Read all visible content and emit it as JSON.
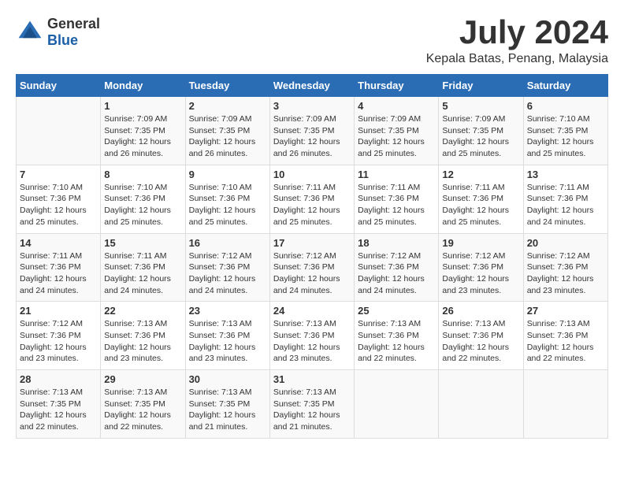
{
  "header": {
    "logo_general": "General",
    "logo_blue": "Blue",
    "month": "July 2024",
    "location": "Kepala Batas, Penang, Malaysia"
  },
  "days_of_week": [
    "Sunday",
    "Monday",
    "Tuesday",
    "Wednesday",
    "Thursday",
    "Friday",
    "Saturday"
  ],
  "weeks": [
    [
      {
        "day": "",
        "info": ""
      },
      {
        "day": "1",
        "info": "Sunrise: 7:09 AM\nSunset: 7:35 PM\nDaylight: 12 hours\nand 26 minutes."
      },
      {
        "day": "2",
        "info": "Sunrise: 7:09 AM\nSunset: 7:35 PM\nDaylight: 12 hours\nand 26 minutes."
      },
      {
        "day": "3",
        "info": "Sunrise: 7:09 AM\nSunset: 7:35 PM\nDaylight: 12 hours\nand 26 minutes."
      },
      {
        "day": "4",
        "info": "Sunrise: 7:09 AM\nSunset: 7:35 PM\nDaylight: 12 hours\nand 25 minutes."
      },
      {
        "day": "5",
        "info": "Sunrise: 7:09 AM\nSunset: 7:35 PM\nDaylight: 12 hours\nand 25 minutes."
      },
      {
        "day": "6",
        "info": "Sunrise: 7:10 AM\nSunset: 7:35 PM\nDaylight: 12 hours\nand 25 minutes."
      }
    ],
    [
      {
        "day": "7",
        "info": "Sunrise: 7:10 AM\nSunset: 7:36 PM\nDaylight: 12 hours\nand 25 minutes."
      },
      {
        "day": "8",
        "info": "Sunrise: 7:10 AM\nSunset: 7:36 PM\nDaylight: 12 hours\nand 25 minutes."
      },
      {
        "day": "9",
        "info": "Sunrise: 7:10 AM\nSunset: 7:36 PM\nDaylight: 12 hours\nand 25 minutes."
      },
      {
        "day": "10",
        "info": "Sunrise: 7:11 AM\nSunset: 7:36 PM\nDaylight: 12 hours\nand 25 minutes."
      },
      {
        "day": "11",
        "info": "Sunrise: 7:11 AM\nSunset: 7:36 PM\nDaylight: 12 hours\nand 25 minutes."
      },
      {
        "day": "12",
        "info": "Sunrise: 7:11 AM\nSunset: 7:36 PM\nDaylight: 12 hours\nand 25 minutes."
      },
      {
        "day": "13",
        "info": "Sunrise: 7:11 AM\nSunset: 7:36 PM\nDaylight: 12 hours\nand 24 minutes."
      }
    ],
    [
      {
        "day": "14",
        "info": "Sunrise: 7:11 AM\nSunset: 7:36 PM\nDaylight: 12 hours\nand 24 minutes."
      },
      {
        "day": "15",
        "info": "Sunrise: 7:11 AM\nSunset: 7:36 PM\nDaylight: 12 hours\nand 24 minutes."
      },
      {
        "day": "16",
        "info": "Sunrise: 7:12 AM\nSunset: 7:36 PM\nDaylight: 12 hours\nand 24 minutes."
      },
      {
        "day": "17",
        "info": "Sunrise: 7:12 AM\nSunset: 7:36 PM\nDaylight: 12 hours\nand 24 minutes."
      },
      {
        "day": "18",
        "info": "Sunrise: 7:12 AM\nSunset: 7:36 PM\nDaylight: 12 hours\nand 24 minutes."
      },
      {
        "day": "19",
        "info": "Sunrise: 7:12 AM\nSunset: 7:36 PM\nDaylight: 12 hours\nand 23 minutes."
      },
      {
        "day": "20",
        "info": "Sunrise: 7:12 AM\nSunset: 7:36 PM\nDaylight: 12 hours\nand 23 minutes."
      }
    ],
    [
      {
        "day": "21",
        "info": "Sunrise: 7:12 AM\nSunset: 7:36 PM\nDaylight: 12 hours\nand 23 minutes."
      },
      {
        "day": "22",
        "info": "Sunrise: 7:13 AM\nSunset: 7:36 PM\nDaylight: 12 hours\nand 23 minutes."
      },
      {
        "day": "23",
        "info": "Sunrise: 7:13 AM\nSunset: 7:36 PM\nDaylight: 12 hours\nand 23 minutes."
      },
      {
        "day": "24",
        "info": "Sunrise: 7:13 AM\nSunset: 7:36 PM\nDaylight: 12 hours\nand 23 minutes."
      },
      {
        "day": "25",
        "info": "Sunrise: 7:13 AM\nSunset: 7:36 PM\nDaylight: 12 hours\nand 22 minutes."
      },
      {
        "day": "26",
        "info": "Sunrise: 7:13 AM\nSunset: 7:36 PM\nDaylight: 12 hours\nand 22 minutes."
      },
      {
        "day": "27",
        "info": "Sunrise: 7:13 AM\nSunset: 7:36 PM\nDaylight: 12 hours\nand 22 minutes."
      }
    ],
    [
      {
        "day": "28",
        "info": "Sunrise: 7:13 AM\nSunset: 7:35 PM\nDaylight: 12 hours\nand 22 minutes."
      },
      {
        "day": "29",
        "info": "Sunrise: 7:13 AM\nSunset: 7:35 PM\nDaylight: 12 hours\nand 22 minutes."
      },
      {
        "day": "30",
        "info": "Sunrise: 7:13 AM\nSunset: 7:35 PM\nDaylight: 12 hours\nand 21 minutes."
      },
      {
        "day": "31",
        "info": "Sunrise: 7:13 AM\nSunset: 7:35 PM\nDaylight: 12 hours\nand 21 minutes."
      },
      {
        "day": "",
        "info": ""
      },
      {
        "day": "",
        "info": ""
      },
      {
        "day": "",
        "info": ""
      }
    ]
  ]
}
